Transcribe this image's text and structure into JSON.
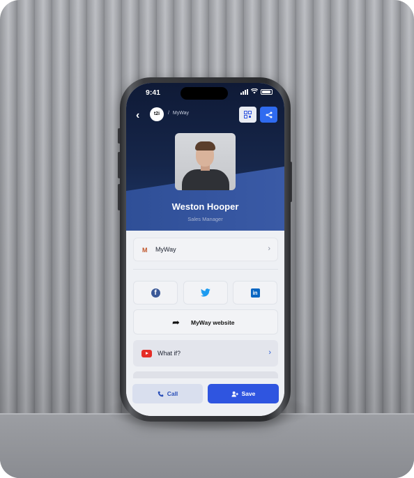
{
  "status_bar": {
    "time": "9:41"
  },
  "header": {
    "logo_text": "t2i",
    "breadcrumb_sep": "/",
    "breadcrumb_page": "MyWay"
  },
  "profile": {
    "name": "Weston Hooper",
    "role": "Sales Manager"
  },
  "links": [
    {
      "label": "MyWay",
      "icon": "myway-logo-icon"
    },
    {
      "label": "What if?",
      "icon": "youtube-icon"
    }
  ],
  "social": [
    "facebook-icon",
    "twitter-icon",
    "linkedin-icon"
  ],
  "website_button": {
    "label": "MyWay website"
  },
  "actions": {
    "call_label": "Call",
    "save_label": "Save"
  },
  "colors": {
    "accent": "#2f55e0",
    "hero_dark": "#0f1a36",
    "hero_band": "#3a5aa6"
  }
}
